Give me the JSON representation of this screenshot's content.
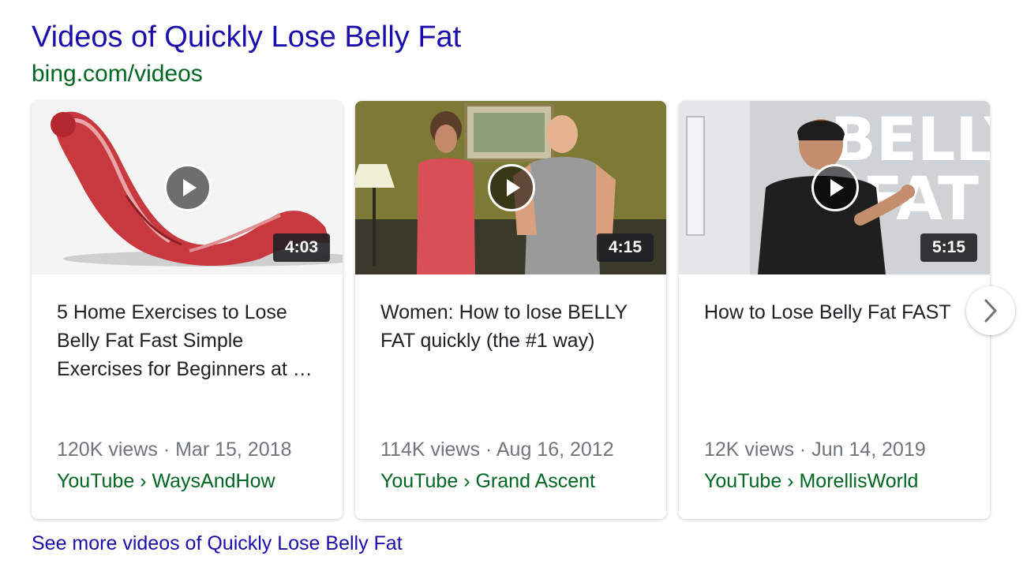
{
  "header": {
    "title": "Videos of Quickly Lose Belly Fat",
    "source": "bing.com/videos"
  },
  "videos": [
    {
      "title": "5 Home Exercises to Lose Belly Fat Fast Simple Exercises for Beginners at …",
      "duration": "4:03",
      "views": "120K views",
      "separator": "·",
      "date": "Mar 15, 2018",
      "platform": "YouTube",
      "channel_separator": "›",
      "channel": "WaysAndHow"
    },
    {
      "title": "Women: How to lose BELLY FAT quickly (the #1 way)",
      "duration": "4:15",
      "views": "114K views",
      "separator": "·",
      "date": "Aug 16, 2012",
      "platform": "YouTube",
      "channel_separator": "›",
      "channel": "Grand Ascent"
    },
    {
      "title": "How to Lose Belly Fat FAST",
      "duration": "5:15",
      "views": "12K views",
      "separator": "·",
      "date": "Jun 14, 2019",
      "platform": "YouTube",
      "channel_separator": "›",
      "channel": "MorellisWorld",
      "thumbnail_text": [
        "BELLY",
        "FAT"
      ]
    }
  ],
  "footer": {
    "see_more": "See more videos of Quickly Lose Belly Fat"
  },
  "icons": {
    "play": "play-icon",
    "next": "chevron-right-icon"
  },
  "colors": {
    "link": "#1a0dab",
    "url_green": "#006621",
    "meta_gray": "#70757a",
    "text": "#202124"
  }
}
